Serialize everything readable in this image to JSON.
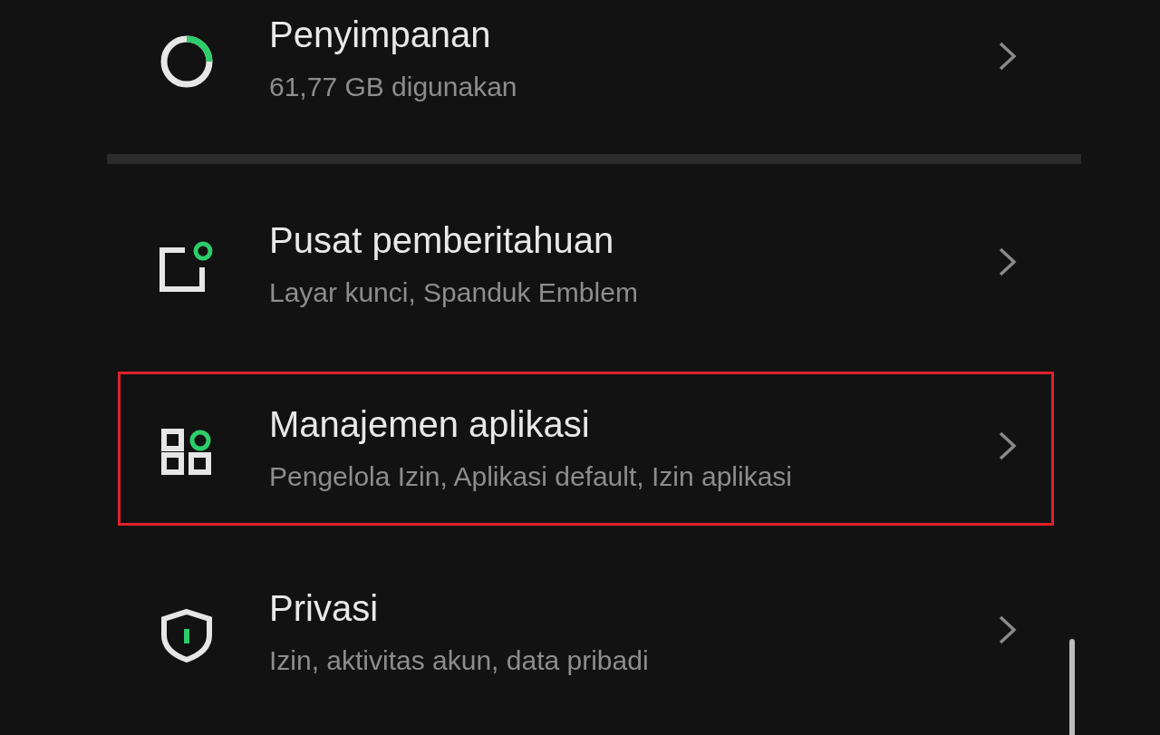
{
  "settings": [
    {
      "kind": "storage",
      "title": "Penyimpanan",
      "subtitle": "61,77 GB digunakan",
      "highlighted": false
    },
    {
      "kind": "notifications",
      "title": "Pusat pemberitahuan",
      "subtitle": "Layar kunci, Spanduk Emblem",
      "highlighted": false
    },
    {
      "kind": "apps",
      "title": "Manajemen aplikasi",
      "subtitle": "Pengelola Izin, Aplikasi default, Izin aplikasi",
      "highlighted": true
    },
    {
      "kind": "privacy",
      "title": "Privasi",
      "subtitle": "Izin, aktivitas akun, data pribadi",
      "highlighted": false
    }
  ]
}
